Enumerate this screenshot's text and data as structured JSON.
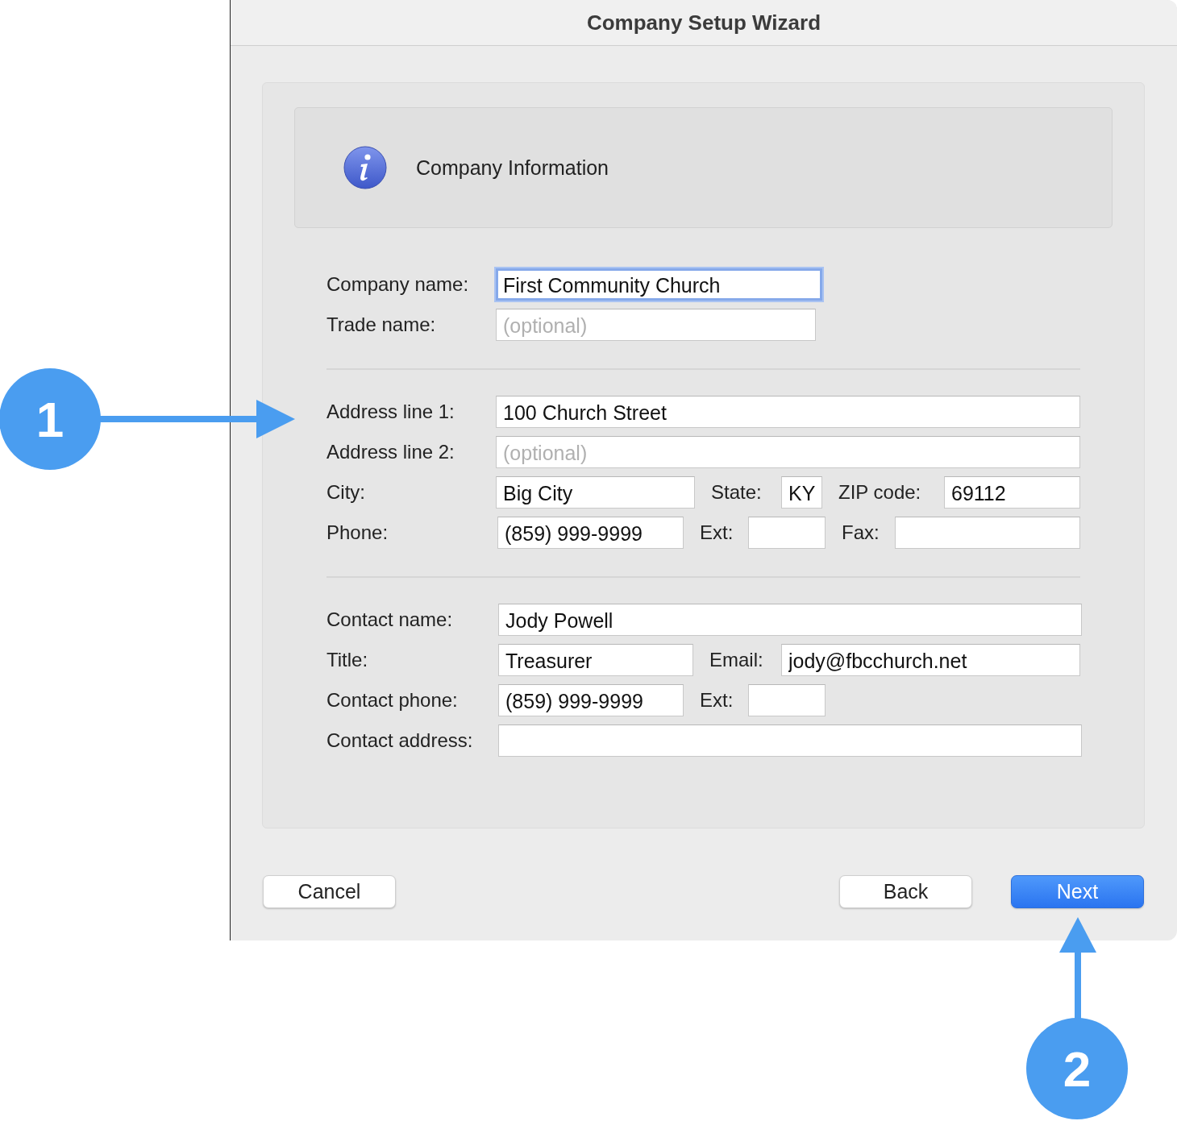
{
  "window": {
    "title": "Company Setup Wizard"
  },
  "header": {
    "title": "Company Information"
  },
  "sections": [
    {
      "rows": [
        [
          {
            "kind": "label",
            "text": "Company name:"
          },
          {
            "kind": "field",
            "value": "First Community Church",
            "focused": true
          }
        ],
        [
          {
            "kind": "label",
            "text": "Trade name:"
          },
          {
            "kind": "field",
            "placeholder": "(optional)",
            "focused": false
          }
        ]
      ]
    },
    {
      "rows": [
        [
          {
            "kind": "label",
            "text": "Address line 1:"
          },
          {
            "kind": "field",
            "value": "100 Church Street",
            "focused": false
          }
        ],
        [
          {
            "kind": "label",
            "text": "Address line 2:"
          },
          {
            "kind": "field",
            "placeholder": "(optional)",
            "focused": false
          }
        ],
        [
          {
            "kind": "label",
            "text": "City:"
          },
          {
            "kind": "field",
            "value": "Big City",
            "focused": false
          },
          {
            "kind": "label",
            "text": "State:"
          },
          {
            "kind": "field",
            "value": "KY",
            "focused": false
          },
          {
            "kind": "label",
            "text": "ZIP code:"
          },
          {
            "kind": "field",
            "value": "69112",
            "focused": false
          }
        ],
        [
          {
            "kind": "label",
            "text": "Phone:"
          },
          {
            "kind": "field",
            "value": "(859) 999-9999",
            "focused": false
          },
          {
            "kind": "label",
            "text": "Ext:"
          },
          {
            "kind": "field",
            "focused": false
          },
          {
            "kind": "label",
            "text": "Fax:"
          },
          {
            "kind": "field",
            "focused": false
          }
        ]
      ]
    },
    {
      "rows": [
        [
          {
            "kind": "label",
            "text": "Contact name:"
          },
          {
            "kind": "field",
            "value": "Jody Powell",
            "focused": false
          }
        ],
        [
          {
            "kind": "label",
            "text": "Title:"
          },
          {
            "kind": "field",
            "value": "Treasurer",
            "focused": false
          },
          {
            "kind": "label",
            "text": "Email:"
          },
          {
            "kind": "field",
            "value": "jody@fbcchurch.net",
            "focused": false
          }
        ],
        [
          {
            "kind": "label",
            "text": "Contact phone:"
          },
          {
            "kind": "field",
            "value": "(859) 999-9999",
            "focused": false
          },
          {
            "kind": "label",
            "text": "Ext:"
          },
          {
            "kind": "field",
            "focused": false
          }
        ],
        [
          {
            "kind": "label",
            "text": "Contact address:"
          },
          {
            "kind": "field",
            "focused": false
          }
        ]
      ]
    }
  ],
  "buttons": [
    {
      "label": "Cancel",
      "default": false
    },
    {
      "label": "Back",
      "default": false
    },
    {
      "label": "Next",
      "default": true
    }
  ],
  "callouts": [
    {
      "label": "1"
    },
    {
      "label": "2"
    }
  ]
}
